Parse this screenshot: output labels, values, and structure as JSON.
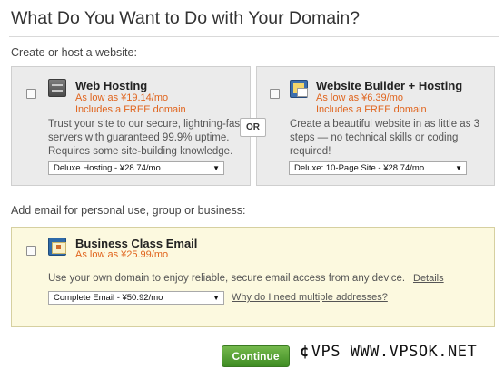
{
  "page": {
    "title": "What Do You Want to Do with Your Domain?"
  },
  "website_section": {
    "label": "Create or host a website:"
  },
  "web_hosting": {
    "title": "Web Hosting",
    "price": "As low as ¥19.14/mo",
    "promo": "Includes a FREE domain",
    "desc_lines": [
      "Trust your site to our secure, lightning-fast",
      "servers with guaranteed 99.9% uptime.",
      "Requires some site-building knowledge."
    ],
    "select_value": "Deluxe Hosting - ¥28.74/mo",
    "icon": "server-icon"
  },
  "or_label": "OR",
  "website_builder": {
    "title": "Website Builder + Hosting",
    "price": "As low as ¥6.39/mo",
    "promo": "Includes a FREE domain",
    "desc_lines": [
      "Create a beautiful website in as little as 3",
      "steps — no technical skills or coding",
      "required!"
    ],
    "select_value": "Deluxe: 10-Page Site - ¥28.74/mo",
    "icon": "website-builder-icon"
  },
  "email_section": {
    "label": "Add email for personal use, group or business:"
  },
  "business_email": {
    "title": "Business Class Email",
    "price": "As low as ¥25.99/mo",
    "desc": "Use your own domain to enjoy reliable, secure email access from any device.",
    "details_link": "Details",
    "select_value": "Complete Email - ¥50.92/mo",
    "why_link": "Why do I need multiple addresses?",
    "icon": "email-icon"
  },
  "continue_label": "Continue",
  "watermark": {
    "text": "VPS WWW.VPSOK.NET"
  },
  "colors": {
    "price_orange": "#e0641d",
    "continue_green": "#4f9e2f",
    "email_panel_bg": "#fcf9df",
    "card_bg": "#ebebeb"
  }
}
